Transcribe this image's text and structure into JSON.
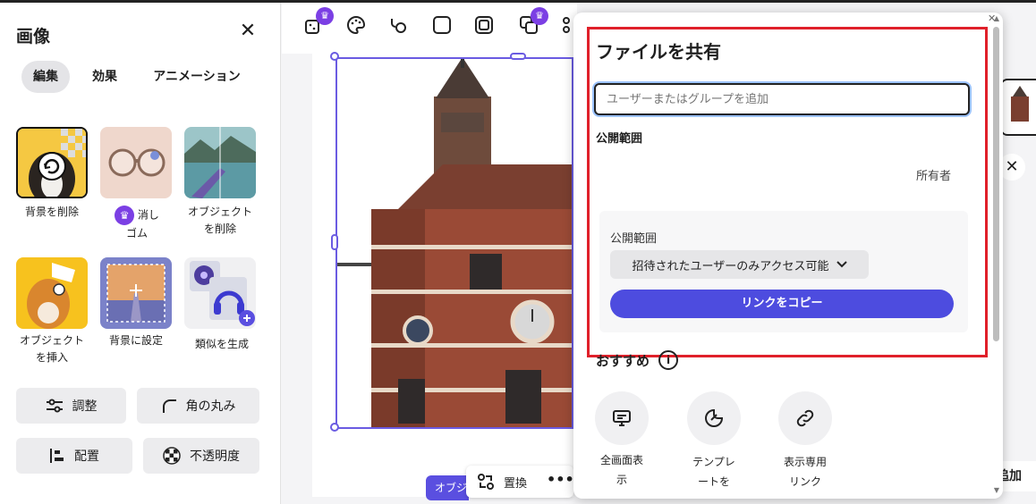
{
  "left_panel": {
    "title": "画像",
    "tabs": [
      "編集",
      "効果",
      "アニメーション"
    ],
    "tools": [
      {
        "label": "背景を削除"
      },
      {
        "label_line1": "消し",
        "label_line2": "ゴム"
      },
      {
        "label_line1": "オブジェクト",
        "label_line2": "を削除"
      },
      {
        "label_line1": "オブジェクト",
        "label_line2": "を挿入"
      },
      {
        "label": "背景に設定"
      },
      {
        "label": "類似を生成"
      }
    ],
    "buttons": {
      "adjust": "調整",
      "round_corners": "角の丸み",
      "position": "配置",
      "opacity": "不透明度"
    }
  },
  "canvas": {
    "float_bar_label": "置換",
    "object_chip": "オブジ"
  },
  "share": {
    "title": "ファイルを共有",
    "input_placeholder": "ユーザーまたはグループを追加",
    "visibility_heading": "公開範囲",
    "owner_label": "所有者",
    "access_label": "公開範囲",
    "access_value": "招待されたユーザーのみアクセス可能",
    "copy_link": "リンクをコピー",
    "recommend": "おすすめ",
    "options": [
      {
        "line1": "全画面表",
        "line2": "示"
      },
      {
        "line1": "テンプレ",
        "line2": "ートを"
      },
      {
        "line1": "表示専用",
        "line2": "リンク"
      }
    ]
  },
  "right": {
    "add_label": "追加"
  },
  "colors": {
    "accent": "#4d4cdf",
    "premium": "#7b3fe4",
    "highlight_frame": "#e0202a",
    "selection": "#6a5be2"
  }
}
